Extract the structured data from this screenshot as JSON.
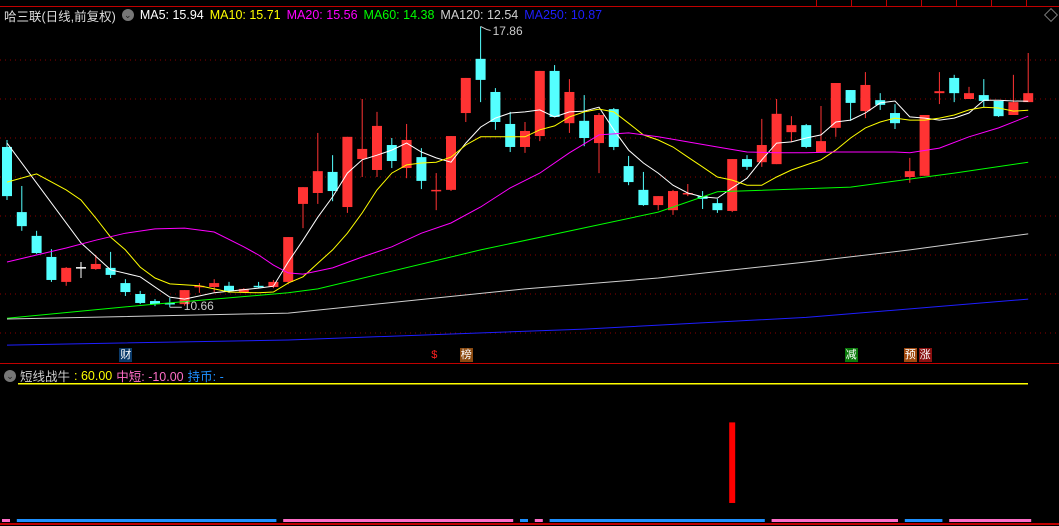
{
  "header": {
    "stock_title": "哈三联(日线,前复权)",
    "ma": [
      {
        "label": "MA5: 15.94",
        "color": "#ffffff"
      },
      {
        "label": "MA10: 15.71",
        "color": "#ffff00"
      },
      {
        "label": "MA20: 15.56",
        "color": "#ff00ff"
      },
      {
        "label": "MA60: 14.38",
        "color": "#00ff00"
      },
      {
        "label": "MA120: 12.54",
        "color": "#d0d0d0"
      },
      {
        "label": "MA250: 10.87",
        "color": "#1e1eff"
      }
    ]
  },
  "annotations": {
    "high_label": "17.86",
    "high_index": 33,
    "low_label": "10.66",
    "low_index": 12
  },
  "events": [
    {
      "label": "财",
      "index": 9,
      "bg": "#0a3a6a",
      "color": "#ffffff"
    },
    {
      "label": "$",
      "index": 30,
      "bg": "transparent",
      "color": "#ff2020"
    },
    {
      "label": "榜",
      "index": 32,
      "bg": "#8b4a10",
      "color": "#ffffff"
    },
    {
      "label": "减",
      "index": 58,
      "bg": "#0a7a0a",
      "color": "#ffffff"
    },
    {
      "label": "预",
      "index": 62,
      "bg": "#a04a10",
      "color": "#ffffff"
    },
    {
      "label": "涨",
      "index": 63,
      "bg": "#8a1010",
      "color": "#ffffff"
    }
  ],
  "indicator": {
    "name": "短线战牛",
    "value1": ": 60.00",
    "value2": "中短: -10.00",
    "value3": "持币: -",
    "line_value": 60,
    "signal_bar": {
      "index": 50,
      "from": 7.5,
      "to": 43
    },
    "state_segments": [
      {
        "from": 1,
        "to": 1,
        "state": "pink"
      },
      {
        "from": 2,
        "to": 19,
        "state": "blue"
      },
      {
        "from": 20,
        "to": 35,
        "state": "pink"
      },
      {
        "from": 36,
        "to": 36,
        "state": "blue"
      },
      {
        "from": 37,
        "to": 37,
        "state": "pink"
      },
      {
        "from": 38,
        "to": 52,
        "state": "blue"
      },
      {
        "from": 53,
        "to": 61,
        "state": "pink"
      },
      {
        "from": 62,
        "to": 64,
        "state": "blue"
      },
      {
        "from": 65,
        "to": 70,
        "state": "pink"
      }
    ]
  },
  "colors": {
    "up": "#ff3333",
    "down": "#54ffff",
    "grid": "#8b0000",
    "blue_state": "#1e90ff",
    "pink_state": "#ff6ec7"
  },
  "chart_data": {
    "type": "candlestick",
    "price_grid": [
      17,
      16,
      15,
      14,
      13,
      12,
      11,
      10
    ],
    "ohlc": [
      [
        14.77,
        14.95,
        13.41,
        13.51
      ],
      [
        13.1,
        13.77,
        12.62,
        12.74
      ],
      [
        12.49,
        12.62,
        12.03,
        12.05
      ],
      [
        11.95,
        12.15,
        11.31,
        11.36
      ],
      [
        11.31,
        11.69,
        11.21,
        11.67
      ],
      [
        11.69,
        11.82,
        11.41,
        11.69
      ],
      [
        11.64,
        12.0,
        11.62,
        11.77
      ],
      [
        11.67,
        12.08,
        11.41,
        11.49
      ],
      [
        11.28,
        11.38,
        10.95,
        11.05
      ],
      [
        11.0,
        11.08,
        10.74,
        10.77
      ],
      [
        10.82,
        10.87,
        10.69,
        10.74
      ],
      [
        10.77,
        10.9,
        10.66,
        10.74
      ],
      [
        10.74,
        11.1,
        10.7,
        11.1
      ],
      [
        11.18,
        11.28,
        11.03,
        11.21
      ],
      [
        11.18,
        11.38,
        11.05,
        11.28
      ],
      [
        11.21,
        11.31,
        11.03,
        11.08
      ],
      [
        11.05,
        11.15,
        11.03,
        11.13
      ],
      [
        11.21,
        11.31,
        11.15,
        11.18
      ],
      [
        11.18,
        11.36,
        11.15,
        11.31
      ],
      [
        11.31,
        12.46,
        11.25,
        12.46
      ],
      [
        13.31,
        13.74,
        12.69,
        13.74
      ],
      [
        13.59,
        15.13,
        13.31,
        14.15
      ],
      [
        14.13,
        14.56,
        13.38,
        13.64
      ],
      [
        13.23,
        15.03,
        13.08,
        15.03
      ],
      [
        14.46,
        16.0,
        14.0,
        14.72
      ],
      [
        14.18,
        15.67,
        14.0,
        15.31
      ],
      [
        14.82,
        15.0,
        14.23,
        14.41
      ],
      [
        14.23,
        15.36,
        13.97,
        14.95
      ],
      [
        14.51,
        14.74,
        13.69,
        13.9
      ],
      [
        13.64,
        14.1,
        13.15,
        13.67
      ],
      [
        13.67,
        15.05,
        13.64,
        15.05
      ],
      [
        15.64,
        16.54,
        15.41,
        16.54
      ],
      [
        17.03,
        17.86,
        15.92,
        16.49
      ],
      [
        16.18,
        16.28,
        15.21,
        15.41
      ],
      [
        15.36,
        15.67,
        14.64,
        14.77
      ],
      [
        14.77,
        15.41,
        14.62,
        15.18
      ],
      [
        15.05,
        16.72,
        14.92,
        16.72
      ],
      [
        16.72,
        16.87,
        15.54,
        15.54
      ],
      [
        15.38,
        16.51,
        15.13,
        16.18
      ],
      [
        15.44,
        16.1,
        14.79,
        15.0
      ],
      [
        14.87,
        15.64,
        14.1,
        15.59
      ],
      [
        15.74,
        15.77,
        14.69,
        14.77
      ],
      [
        14.28,
        14.54,
        13.79,
        13.87
      ],
      [
        13.67,
        14.13,
        13.26,
        13.28
      ],
      [
        13.28,
        13.51,
        13.15,
        13.51
      ],
      [
        13.15,
        13.67,
        13.03,
        13.64
      ],
      [
        13.56,
        13.82,
        13.51,
        13.59
      ],
      [
        13.51,
        13.64,
        13.18,
        13.44
      ],
      [
        13.33,
        13.44,
        13.08,
        13.15
      ],
      [
        13.13,
        14.46,
        13.1,
        14.46
      ],
      [
        14.46,
        14.56,
        14.18,
        14.26
      ],
      [
        14.38,
        15.49,
        14.26,
        14.82
      ],
      [
        14.33,
        16.0,
        14.33,
        15.62
      ],
      [
        15.15,
        15.56,
        14.9,
        15.33
      ],
      [
        15.33,
        15.36,
        14.74,
        14.77
      ],
      [
        14.64,
        15.82,
        14.62,
        14.92
      ],
      [
        15.26,
        16.41,
        15.03,
        16.41
      ],
      [
        16.23,
        16.23,
        15.44,
        15.9
      ],
      [
        15.69,
        16.69,
        15.51,
        16.36
      ],
      [
        15.97,
        16.15,
        15.72,
        15.85
      ],
      [
        15.64,
        15.87,
        15.23,
        15.38
      ],
      [
        14.0,
        14.49,
        13.85,
        14.15
      ],
      [
        14.03,
        15.59,
        14.03,
        15.59
      ],
      [
        16.15,
        16.69,
        15.87,
        16.2
      ],
      [
        16.54,
        16.62,
        15.92,
        16.15
      ],
      [
        16.0,
        16.31,
        16.0,
        16.15
      ],
      [
        16.1,
        16.51,
        15.79,
        15.95
      ],
      [
        15.95,
        15.95,
        15.54,
        15.56
      ],
      [
        15.59,
        16.62,
        15.59,
        15.92
      ],
      [
        15.92,
        17.18,
        15.92,
        16.15
      ]
    ],
    "ma_series": [
      {
        "name": "MA5",
        "color": "#ffffff",
        "points": [
          [
            1,
            14.87
          ],
          [
            6,
            12.31
          ],
          [
            8,
            11.62
          ],
          [
            10,
            11.44
          ],
          [
            12,
            10.92
          ],
          [
            13,
            10.87
          ],
          [
            15,
            11.03
          ],
          [
            18,
            11.15
          ],
          [
            19,
            11.2
          ],
          [
            20,
            11.82
          ],
          [
            21,
            12.38
          ],
          [
            22,
            12.97
          ],
          [
            23,
            13.49
          ],
          [
            24,
            14.1
          ],
          [
            25,
            14.44
          ],
          [
            26,
            14.56
          ],
          [
            27,
            14.69
          ],
          [
            28,
            14.87
          ],
          [
            29,
            14.64
          ],
          [
            30,
            14.49
          ],
          [
            31,
            14.38
          ],
          [
            32,
            14.87
          ],
          [
            33,
            15.28
          ],
          [
            34,
            15.51
          ],
          [
            35,
            15.64
          ],
          [
            36,
            15.67
          ],
          [
            37,
            15.72
          ],
          [
            38,
            15.54
          ],
          [
            39,
            15.67
          ],
          [
            40,
            15.69
          ],
          [
            41,
            15.79
          ],
          [
            42,
            15.21
          ],
          [
            43,
            14.69
          ],
          [
            44,
            14.36
          ],
          [
            45,
            14.1
          ],
          [
            46,
            13.79
          ],
          [
            47,
            13.59
          ],
          [
            48,
            13.49
          ],
          [
            49,
            13.46
          ],
          [
            50,
            13.72
          ],
          [
            51,
            13.97
          ],
          [
            52,
            14.44
          ],
          [
            53,
            14.87
          ],
          [
            54,
            14.9
          ],
          [
            55,
            15.0
          ],
          [
            56,
            15.08
          ],
          [
            57,
            15.41
          ],
          [
            58,
            15.46
          ],
          [
            59,
            15.64
          ],
          [
            60,
            15.9
          ],
          [
            61,
            15.95
          ],
          [
            62,
            15.54
          ],
          [
            63,
            15.51
          ],
          [
            64,
            15.46
          ],
          [
            65,
            15.51
          ],
          [
            66,
            15.64
          ],
          [
            67,
            15.97
          ],
          [
            68,
            15.97
          ],
          [
            69,
            15.95
          ],
          [
            70,
            15.94
          ]
        ]
      },
      {
        "name": "MA10",
        "color": "#ffff00",
        "points": [
          [
            1,
            13.87
          ],
          [
            3,
            14.08
          ],
          [
            5,
            13.67
          ],
          [
            6,
            13.41
          ],
          [
            7,
            12.95
          ],
          [
            8,
            12.46
          ],
          [
            9,
            12.13
          ],
          [
            10,
            11.69
          ],
          [
            11,
            11.41
          ],
          [
            12,
            11.26
          ],
          [
            14,
            11.21
          ],
          [
            16,
            11.05
          ],
          [
            18,
            11.03
          ],
          [
            19,
            11.05
          ],
          [
            20,
            11.28
          ],
          [
            21,
            11.44
          ],
          [
            22,
            11.79
          ],
          [
            23,
            12.13
          ],
          [
            24,
            12.56
          ],
          [
            25,
            13.08
          ],
          [
            26,
            13.67
          ],
          [
            27,
            14.1
          ],
          [
            28,
            14.31
          ],
          [
            29,
            14.36
          ],
          [
            30,
            14.38
          ],
          [
            31,
            14.51
          ],
          [
            32,
            14.82
          ],
          [
            33,
            15.03
          ],
          [
            35,
            15.03
          ],
          [
            36,
            15.03
          ],
          [
            37,
            15.21
          ],
          [
            38,
            15.31
          ],
          [
            39,
            15.54
          ],
          [
            40,
            15.67
          ],
          [
            41,
            15.74
          ],
          [
            42,
            15.67
          ],
          [
            43,
            15.38
          ],
          [
            44,
            15.08
          ],
          [
            45,
            14.95
          ],
          [
            46,
            14.77
          ],
          [
            47,
            14.51
          ],
          [
            48,
            14.26
          ],
          [
            49,
            14.0
          ],
          [
            50,
            13.92
          ],
          [
            51,
            13.79
          ],
          [
            52,
            13.79
          ],
          [
            53,
            14.0
          ],
          [
            54,
            14.18
          ],
          [
            55,
            14.31
          ],
          [
            56,
            14.44
          ],
          [
            57,
            14.69
          ],
          [
            58,
            15.0
          ],
          [
            59,
            15.26
          ],
          [
            60,
            15.41
          ],
          [
            61,
            15.51
          ],
          [
            62,
            15.46
          ],
          [
            63,
            15.46
          ],
          [
            64,
            15.51
          ],
          [
            65,
            15.59
          ],
          [
            66,
            15.72
          ],
          [
            67,
            15.79
          ],
          [
            68,
            15.77
          ],
          [
            69,
            15.69
          ],
          [
            70,
            15.71
          ]
        ]
      },
      {
        "name": "MA20",
        "color": "#ff00ff",
        "points": [
          [
            1,
            11.82
          ],
          [
            3,
            12.0
          ],
          [
            5,
            12.18
          ],
          [
            7,
            12.38
          ],
          [
            9,
            12.56
          ],
          [
            11,
            12.67
          ],
          [
            13,
            12.69
          ],
          [
            15,
            12.59
          ],
          [
            17,
            12.21
          ],
          [
            18,
            12.0
          ],
          [
            19,
            11.74
          ],
          [
            20,
            11.54
          ],
          [
            21,
            11.51
          ],
          [
            23,
            11.67
          ],
          [
            25,
            11.95
          ],
          [
            27,
            12.21
          ],
          [
            29,
            12.56
          ],
          [
            31,
            12.82
          ],
          [
            33,
            13.23
          ],
          [
            35,
            13.72
          ],
          [
            37,
            14.1
          ],
          [
            39,
            14.62
          ],
          [
            41,
            15.08
          ],
          [
            43,
            15.13
          ],
          [
            45,
            15.03
          ],
          [
            47,
            14.9
          ],
          [
            49,
            14.77
          ],
          [
            51,
            14.64
          ],
          [
            53,
            14.62
          ],
          [
            55,
            14.62
          ],
          [
            57,
            14.64
          ],
          [
            59,
            14.64
          ],
          [
            61,
            14.64
          ],
          [
            62,
            14.62
          ],
          [
            64,
            14.74
          ],
          [
            66,
            15.03
          ],
          [
            68,
            15.26
          ],
          [
            70,
            15.56
          ]
        ]
      },
      {
        "name": "MA60",
        "color": "#00ff00",
        "points": [
          [
            1,
            10.38
          ],
          [
            11,
            10.74
          ],
          [
            20,
            11.03
          ],
          [
            22,
            11.13
          ],
          [
            33,
            12.13
          ],
          [
            45,
            13.1
          ],
          [
            49,
            13.62
          ],
          [
            58,
            13.74
          ],
          [
            65,
            14.1
          ],
          [
            70,
            14.38
          ]
        ]
      },
      {
        "name": "MA120",
        "color": "#d0d0d0",
        "points": [
          [
            1,
            10.36
          ],
          [
            20,
            10.51
          ],
          [
            36,
            11.13
          ],
          [
            45,
            11.41
          ],
          [
            55,
            11.82
          ],
          [
            62,
            12.13
          ],
          [
            70,
            12.54
          ]
        ]
      },
      {
        "name": "MA250",
        "color": "#1e1eff",
        "points": [
          [
            1,
            9.69
          ],
          [
            20,
            9.82
          ],
          [
            40,
            10.1
          ],
          [
            55,
            10.4
          ],
          [
            70,
            10.87
          ]
        ]
      }
    ]
  }
}
